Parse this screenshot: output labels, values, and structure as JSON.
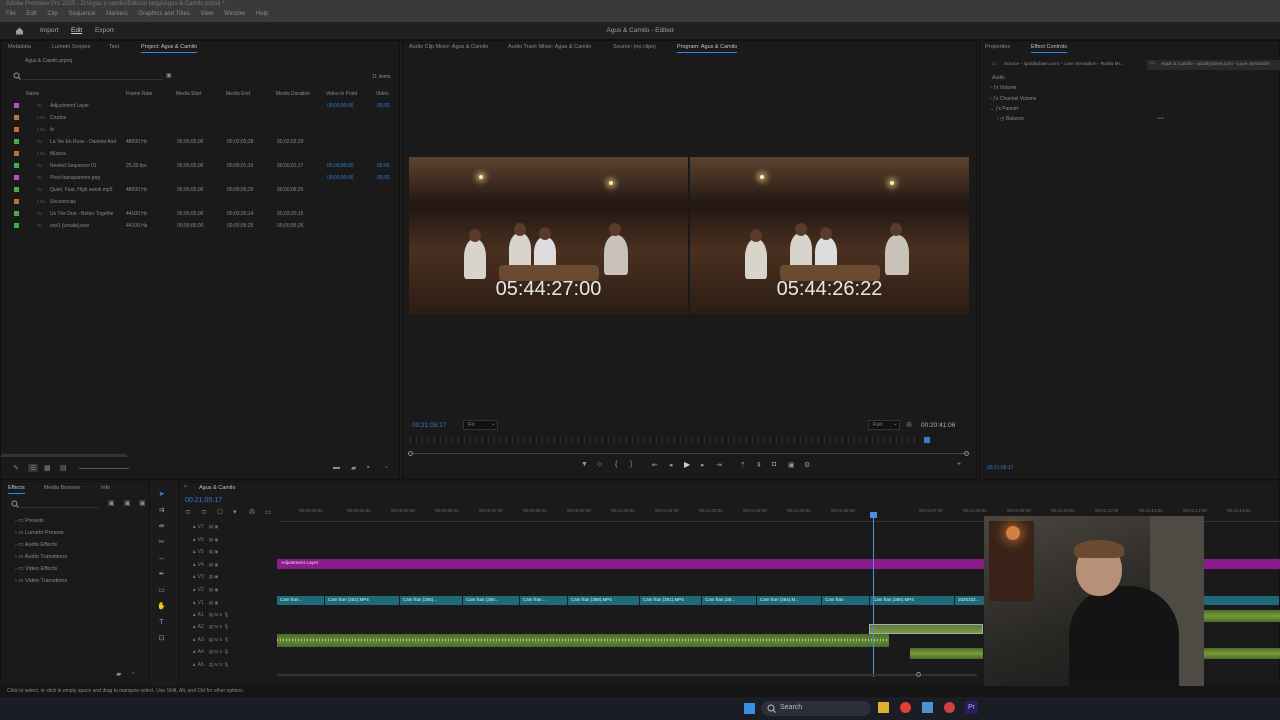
{
  "window": {
    "title": "Adobe Premiere Pro 2025 - D:\\Agus y camilo\\Edicion larga\\Agus & Camilo.prproj *",
    "menus": [
      "File",
      "Edit",
      "Clip",
      "Sequence",
      "Markers",
      "Graphics and Titles",
      "View",
      "Window",
      "Help"
    ]
  },
  "workspace": {
    "items": [
      "Import",
      "Edit",
      "Export"
    ],
    "active": "Edit",
    "project_title": "Agus & Camilo - Edited"
  },
  "project_panel": {
    "tabs": [
      "Metadata",
      "Lumetri Scopes",
      "Text",
      "Project: Agus & Camilo"
    ],
    "path": "Agus & Camilo.prproj",
    "item_count": "11 items",
    "columns": [
      "Name",
      "Frame Rate",
      "Media Start",
      "Media End",
      "Media Duration",
      "Video In Point",
      "Video"
    ],
    "rows": [
      {
        "name": "Adjustment Layer",
        "color": "#b44fc4",
        "frame_rate": "",
        "start": "",
        "end": "",
        "duration": "",
        "vin": "00;00;00;00",
        "v": "00;00"
      },
      {
        "name": "Crudos",
        "color": "#c07030",
        "frame_rate": "",
        "start": "",
        "end": "",
        "duration": "",
        "vin": "",
        "v": ""
      },
      {
        "name": "fx",
        "color": "#c07030",
        "frame_rate": "",
        "start": "",
        "end": "",
        "duration": "",
        "vin": "",
        "v": ""
      },
      {
        "name": "La Vie En Rose - Daniela And",
        "color": "#3fae4a",
        "frame_rate": "48000 Hz",
        "start": "00;00;00;00",
        "end": "00;02;03;28",
        "duration": "00;02;03;29",
        "vin": "",
        "v": ""
      },
      {
        "name": "Música",
        "color": "#c07030",
        "frame_rate": "",
        "start": "",
        "end": "",
        "duration": "",
        "vin": "",
        "v": ""
      },
      {
        "name": "Nested Sequence 01",
        "color": "#3fae4a",
        "frame_rate": "25.00 fps",
        "start": "00;00;00;00",
        "end": "00;00;01;16",
        "duration": "00;00;01;17",
        "vin": "00;00;00;00",
        "v": "00;00"
      },
      {
        "name": "Pixel transparente.png",
        "color": "#b44fc4",
        "frame_rate": "",
        "start": "",
        "end": "",
        "duration": "",
        "vin": "00;00;00;00",
        "v": "00;00"
      },
      {
        "name": "Quiet, Fast, High swish.mp3",
        "color": "#3fae4a",
        "frame_rate": "48000 Hz",
        "start": "00;00;00;00",
        "end": "00;00;05;25",
        "duration": "00;00;05;26",
        "vin": "",
        "v": ""
      },
      {
        "name": "Secuencias",
        "color": "#c07030",
        "frame_rate": "",
        "start": "",
        "end": "",
        "duration": "",
        "vin": "",
        "v": ""
      },
      {
        "name": "Us The Duo - Better Togethe",
        "color": "#3fae4a",
        "frame_rate": "44100 Hz",
        "start": "00;00;00;00",
        "end": "00;03;20;14",
        "duration": "00;03;20;15",
        "vin": "",
        "v": ""
      },
      {
        "name": "vos1 [vocals].wav",
        "color": "#3fae4a",
        "frame_rate": "44100 Hz",
        "start": "00;00;00;00",
        "end": "00;00;05;25",
        "duration": "00;00;05;26",
        "vin": "",
        "v": ""
      }
    ]
  },
  "monitor": {
    "tabs": [
      "Audio Clip Mixer: Agus & Camilo",
      "Audio Track Mixer: Agus & Camilo",
      "Source: (no clips)",
      "Program: Agus & Camilo"
    ],
    "left_timecode": "05:44:27:00",
    "right_timecode": "05:44:26:22",
    "current_time": "00:21:05:17",
    "fit": "Fit",
    "quality": "Full",
    "duration": "00:20:41:06"
  },
  "effect_controls": {
    "tabs": [
      "Properties",
      "Effect Controls"
    ],
    "source": "Source - spotifydown.com - Love Sensation - Radio Mi...",
    "target": "Agus & Camilo - spotifydown.com - Love Sensation",
    "section": "Audio",
    "items": [
      "Volume",
      "Channel Volume",
      "Panner",
      "Balance"
    ],
    "time": "00:21:05:17"
  },
  "effects_panel": {
    "tabs": [
      "Effects",
      "Media Browser",
      "Info"
    ],
    "items": [
      "Presets",
      "Lumetri Presets",
      "Audio Effects",
      "Audio Transitions",
      "Video Effects",
      "Video Transitions"
    ]
  },
  "timeline": {
    "tab": "Agus & Camilo",
    "timecode": "00:21:05:17",
    "ruler": [
      "00:20:53:00",
      "00:20:54:00",
      "00:20:55:00",
      "00:20:56:00",
      "00:20:57:00",
      "00:20:58:00",
      "00:20:59:00",
      "00:21:00:00",
      "00:21:01:00",
      "00:21:02:00",
      "00:21:03:00",
      "00:21:04:00",
      "00:21:05:00",
      "00:21:07:00",
      "00:21:08:00",
      "00:21:09:00",
      "00:21:10:00",
      "00:21:11:00",
      "00:21:12:00",
      "00:21:13:00",
      "00:21:14:00"
    ],
    "video_tracks": [
      "V7",
      "V6",
      "V5",
      "V4",
      "V3",
      "V2",
      "V1"
    ],
    "audio_tracks": [
      "A1",
      "A2",
      "A3",
      "A4",
      "A5"
    ],
    "adjustment_clip": "Adjustment Layer",
    "v1_clips": [
      "Cam fran...",
      "Cam fran (352).MP4",
      "Cam fran (355)...",
      "Cam fran (356...",
      "Cam fran...",
      "Cam fran (358).MP4",
      "Cam fran (361).MP4",
      "Cam fran (36...",
      "Cam fran (364).M...",
      "Cam fran",
      "Cam fran (366).MP4",
      "2025102..."
    ]
  },
  "status_bar": "Click to select, or click in empty space and drag to marquee select. Use Shift, Alt, and Ctrl for other options.",
  "taskbar": {
    "search": "Search"
  }
}
